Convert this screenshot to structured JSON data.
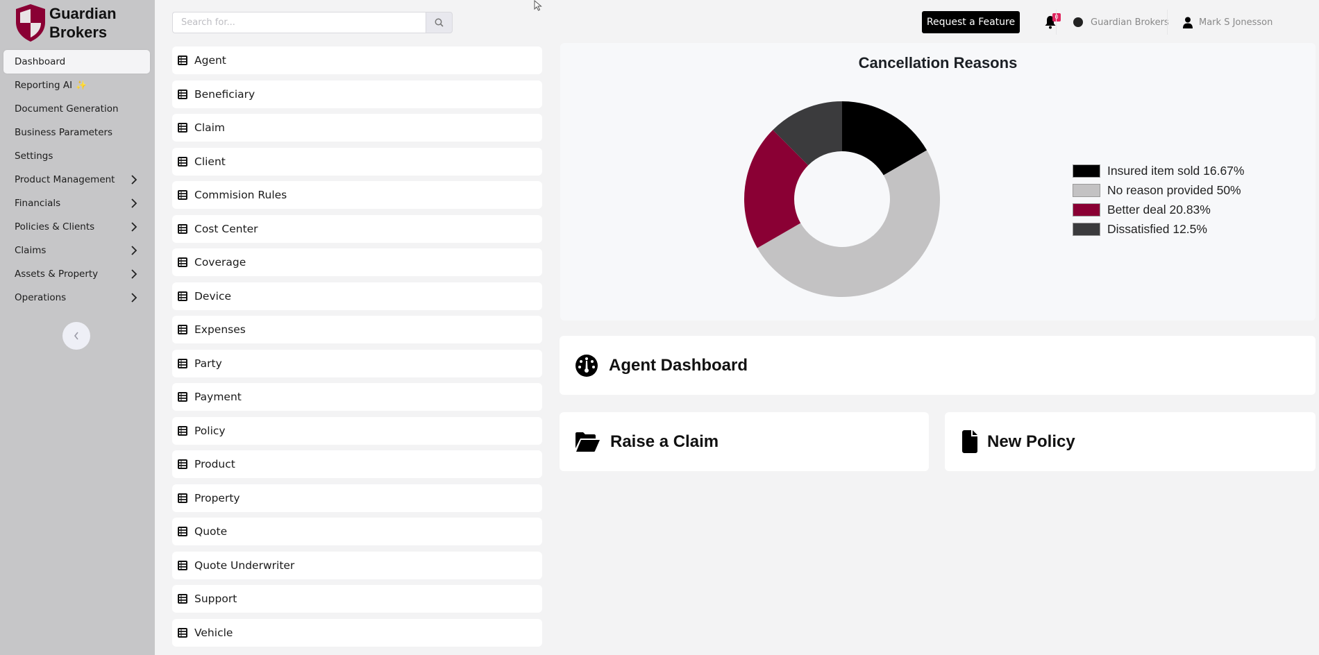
{
  "brand": {
    "name_line1": "Guardian",
    "name_line2": "Brokers",
    "accent_color": "#8a0034"
  },
  "sidebar": {
    "items": [
      {
        "label": "Dashboard",
        "active": true,
        "has_children": false
      },
      {
        "label": "Reporting AI",
        "active": false,
        "has_children": false,
        "badge_icon": "sparkle-icon"
      },
      {
        "label": "Document Generation",
        "active": false,
        "has_children": false
      },
      {
        "label": "Business Parameters",
        "active": false,
        "has_children": false
      },
      {
        "label": "Settings",
        "active": false,
        "has_children": false
      },
      {
        "label": "Product Management",
        "active": false,
        "has_children": true
      },
      {
        "label": "Financials",
        "active": false,
        "has_children": true
      },
      {
        "label": "Policies & Clients",
        "active": false,
        "has_children": true
      },
      {
        "label": "Claims",
        "active": false,
        "has_children": true
      },
      {
        "label": "Assets & Property",
        "active": false,
        "has_children": true
      },
      {
        "label": "Operations",
        "active": false,
        "has_children": true
      }
    ],
    "collapse_icon": "chevron-left-icon"
  },
  "header": {
    "search": {
      "placeholder": "Search for...",
      "value": ""
    },
    "request_feature_label": "Request a Feature",
    "notifications_count": "0",
    "organization": "Guardian Brokers",
    "user_name": "Mark S Jonesson"
  },
  "entities": [
    {
      "label": "Agent"
    },
    {
      "label": "Beneficiary"
    },
    {
      "label": "Claim"
    },
    {
      "label": "Client"
    },
    {
      "label": "Commision Rules"
    },
    {
      "label": "Cost Center"
    },
    {
      "label": "Coverage"
    },
    {
      "label": "Device"
    },
    {
      "label": "Expenses"
    },
    {
      "label": "Party"
    },
    {
      "label": "Payment"
    },
    {
      "label": "Policy"
    },
    {
      "label": "Product"
    },
    {
      "label": "Property"
    },
    {
      "label": "Quote"
    },
    {
      "label": "Quote Underwriter"
    },
    {
      "label": "Support"
    },
    {
      "label": "Vehicle"
    }
  ],
  "chart_data": {
    "type": "pie",
    "donut": true,
    "title": "Cancellation Reasons",
    "legend_position": "right",
    "slices": [
      {
        "label": "Insured item sold",
        "value": 16.67,
        "display": "Insured item sold 16.67%",
        "color": "#000000"
      },
      {
        "label": "No reason provided",
        "value": 50,
        "display": "No reason provided 50%",
        "color": "#c3c2c3"
      },
      {
        "label": "Better deal",
        "value": 20.83,
        "display": "Better deal 20.83%",
        "color": "#8a0034"
      },
      {
        "label": "Dissatisfied",
        "value": 12.5,
        "display": "Dissatisfied 12.5%",
        "color": "#3b3b3d"
      }
    ]
  },
  "cards": {
    "agent_dashboard": "Agent Dashboard",
    "raise_claim": "Raise a Claim",
    "new_policy": "New Policy"
  }
}
